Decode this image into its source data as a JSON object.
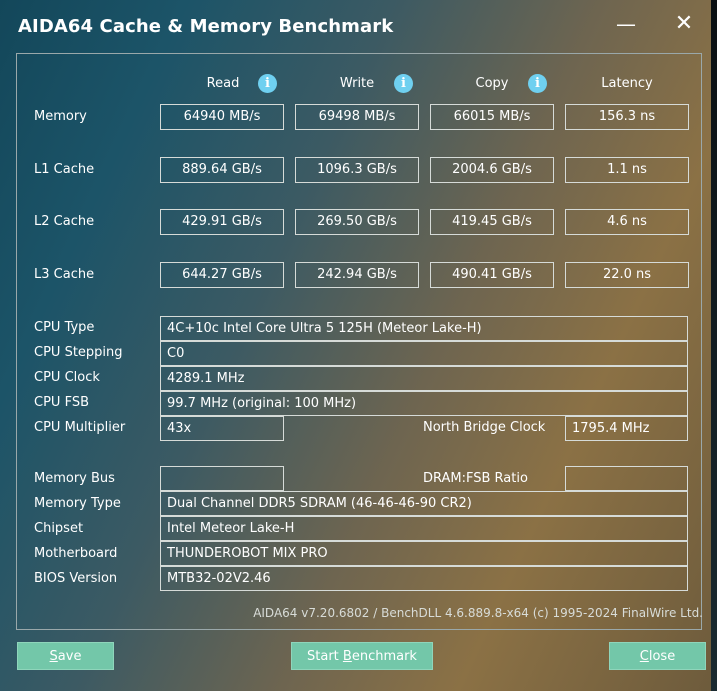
{
  "window": {
    "title": "AIDA64 Cache & Memory Benchmark",
    "minimize": "—",
    "close": "✕"
  },
  "headers": {
    "read": "Read",
    "write": "Write",
    "copy": "Copy",
    "latency": "Latency",
    "info_glyph": "i"
  },
  "bench_rows": [
    {
      "label": "Memory",
      "read": "64940 MB/s",
      "write": "69498 MB/s",
      "copy": "66015 MB/s",
      "latency": "156.3 ns"
    },
    {
      "label": "L1 Cache",
      "read": "889.64 GB/s",
      "write": "1096.3 GB/s",
      "copy": "2004.6 GB/s",
      "latency": "1.1 ns"
    },
    {
      "label": "L2 Cache",
      "read": "429.91 GB/s",
      "write": "269.50 GB/s",
      "copy": "419.45 GB/s",
      "latency": "4.6 ns"
    },
    {
      "label": "L3 Cache",
      "read": "644.27 GB/s",
      "write": "242.94 GB/s",
      "copy": "490.41 GB/s",
      "latency": "22.0 ns"
    }
  ],
  "cpu": {
    "type_label": "CPU Type",
    "type": "4C+10c Intel Core Ultra 5 125H  (Meteor Lake-H)",
    "stepping_label": "CPU Stepping",
    "stepping": "C0",
    "clock_label": "CPU Clock",
    "clock": "4289.1 MHz",
    "fsb_label": "CPU FSB",
    "fsb": "99.7 MHz  (original: 100 MHz)",
    "multiplier_label": "CPU Multiplier",
    "multiplier": "43x",
    "nb_clock_label": "North Bridge Clock",
    "nb_clock": "1795.4 MHz"
  },
  "system": {
    "membus_label": "Memory Bus",
    "membus": "",
    "dram_ratio_label": "DRAM:FSB Ratio",
    "dram_ratio": "",
    "memtype_label": "Memory Type",
    "memtype": "Dual Channel DDR5 SDRAM  (46-46-46-90 CR2)",
    "chipset_label": "Chipset",
    "chipset": "Intel Meteor Lake-H",
    "motherboard_label": "Motherboard",
    "motherboard": "THUNDEROBOT MIX PRO",
    "bios_label": "BIOS Version",
    "bios": "MTB32-02V2.46"
  },
  "footer": "AIDA64 v7.20.6802 / BenchDLL 4.6.889.8-x64  (c) 1995-2024 FinalWire Ltd.",
  "buttons": {
    "save_first": "S",
    "save_rest": "ave",
    "start_pre": "Start ",
    "start_accel": "B",
    "start_rest": "enchmark",
    "close_first": "C",
    "close_rest": "lose"
  }
}
